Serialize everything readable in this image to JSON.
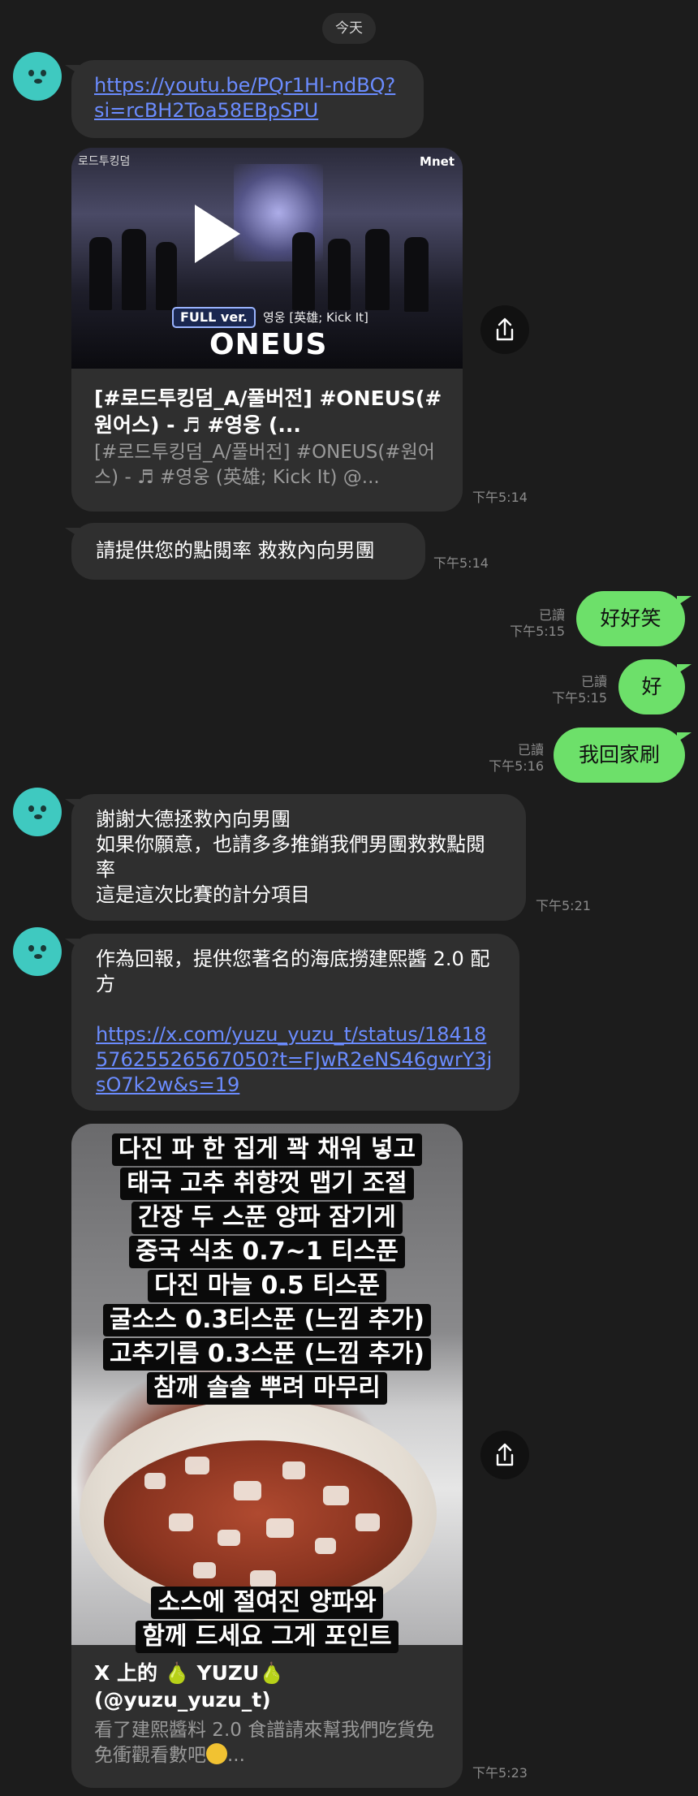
{
  "date_separator": "今天",
  "messages": {
    "m1_link": "https://youtu.be/PQr1HI-ndBQ?si=rcBH2Toa58EBpSPU",
    "video_card": {
      "corner_logo": "Mnet",
      "corner_title": "로드투킹덤",
      "badge": "FULL ver.",
      "song_caption": "영웅 [英雄; Kick It]",
      "brand": "ONEUS",
      "title": "[#로드투킹덤_A/풀버전] #ONEUS(#원어스) - ♬ #영웅 (...",
      "desc": "[#로드투킹덤_A/풀버전] #ONEUS(#원어스) - ♬ #영웅 (英雄; Kick It) @...",
      "time": "下午5:14"
    },
    "m3": {
      "text": "請提供您的點閱率 救救內向男團",
      "time": "下午5:14"
    },
    "out1": {
      "text": "好好笑",
      "status": "已讀",
      "time": "下午5:15"
    },
    "out2": {
      "text": "好",
      "status": "已讀",
      "time": "下午5:15"
    },
    "out3": {
      "text": "我回家刷",
      "status": "已讀",
      "time": "下午5:16"
    },
    "m4": {
      "line1": "謝謝大德拯救內向男團",
      "line2": "如果你願意，也請多多推銷我們男團救救點閱率",
      "line3": "這是這次比賽的計分項目",
      "time": "下午5:21"
    },
    "m5": {
      "text": "作為回報，提供您著名的海底撈建熙醬 2.0 配方",
      "link": "https://x.com/yuzu_yuzu_t/status/1841857625526567050?t=FJwR2eNS46gwrY3jsO7k2w&s=19"
    },
    "recipe_card": {
      "captions": [
        "다진 파 한 집게 꽉 채워 넣고",
        "태국 고추 취향껏 맵기 조절",
        "간장 두 스푼 양파 잠기게",
        "중국 식초 0.7~1 티스푼",
        "다진 마늘 0.5 티스푼",
        "굴소스 0.3티스푼 (느낌 추가)",
        "고추기름 0.3스푼 (느낌 추가)",
        "참깨 솔솔 뿌려 마무리"
      ],
      "bottom_caption_1": "소스에 절여진 양파와",
      "bottom_caption_2": "함께 드세요 그게 포인트",
      "title": "X 上的 🍐 YUZU🍐 (@yuzu_yuzu_t)",
      "desc": "看了建熙醬料 2.0 食譜請來幫我們吃貨免免衝觀看數吧",
      "desc_suffix": "...",
      "time": "下午5:23"
    }
  },
  "icons": {
    "avatar": "teal-bear-avatar",
    "share": "share-upload-icon",
    "play": "play-icon",
    "emoji": "pleading-face-emoji"
  },
  "colors": {
    "background": "#1c1c1c",
    "incoming_bubble": "#2f2f2f",
    "outgoing_bubble": "#6de06a",
    "link": "#6b8cff",
    "avatar": "#3fc9c0"
  }
}
